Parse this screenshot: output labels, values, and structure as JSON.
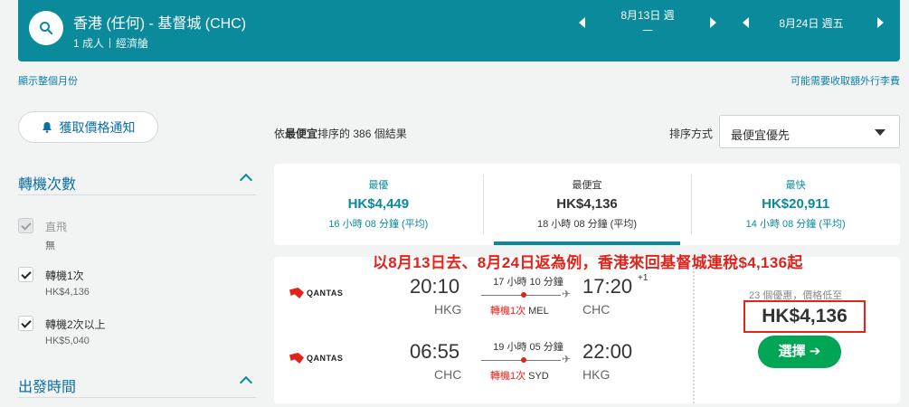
{
  "search": {
    "route": "香港 (任何) - 基督城 (CHC)",
    "passengers": "1 成人",
    "cabin": "經濟艙",
    "depart_date": "8月13日 週一",
    "return_date": "8月24日 週五"
  },
  "links": {
    "whole_month": "顯示整個月份",
    "baggage_fees": "可能需要收取額外行李費"
  },
  "sidebar": {
    "price_alert": "獲取價格通知",
    "stops_title": "轉機次數",
    "stops": [
      {
        "label": "直飛",
        "price": "無",
        "checked": true,
        "disabled": true
      },
      {
        "label": "轉機1次",
        "price": "HK$4,136",
        "checked": true,
        "disabled": false
      },
      {
        "label": "轉機2次以上",
        "price": "HK$5,040",
        "checked": true,
        "disabled": false
      }
    ],
    "depart_time_title": "出發時間"
  },
  "results": {
    "count_prefix": "依",
    "count_bold": "最便宜",
    "count_suffix": "排序的 386 個結果",
    "sort_label": "排序方式",
    "sort_value": "最便宜優先"
  },
  "tabs": [
    {
      "label": "最優",
      "price": "HK$4,449",
      "duration": "16 小時 08 分鐘 (平均)",
      "active": false
    },
    {
      "label": "最便宜",
      "price": "HK$4,136",
      "duration": "18 小時 08 分鐘 (平均)",
      "active": true
    },
    {
      "label": "最快",
      "price": "HK$20,911",
      "duration": "14 小時 08 分鐘 (平均)",
      "active": false
    }
  ],
  "annotation": "以8月13日去、8月24日返為例，香港來回基督城連稅$4,136起",
  "result": {
    "airline": "QANTAS",
    "outbound": {
      "dep_time": "20:10",
      "dep_airport": "HKG",
      "duration": "17 小時 10 分鐘",
      "stops": "轉機1次",
      "via": "MEL",
      "arr_time": "17:20",
      "arr_offset": "+1",
      "arr_airport": "CHC"
    },
    "inbound": {
      "dep_time": "06:55",
      "dep_airport": "CHC",
      "duration": "19 小時 05 分鐘",
      "stops": "轉機1次",
      "via": "SYD",
      "arr_time": "22:00",
      "arr_airport": "HKG"
    },
    "deals": "23 個優惠，價格低至",
    "price": "HK$4,136",
    "select_label": "選擇 ➔"
  },
  "colors": {
    "header_bg": "#0b8a9c",
    "accent": "#0b8a9c",
    "link": "#0b6fa4",
    "highlight": "#e2231a",
    "select_button": "#00a556"
  }
}
